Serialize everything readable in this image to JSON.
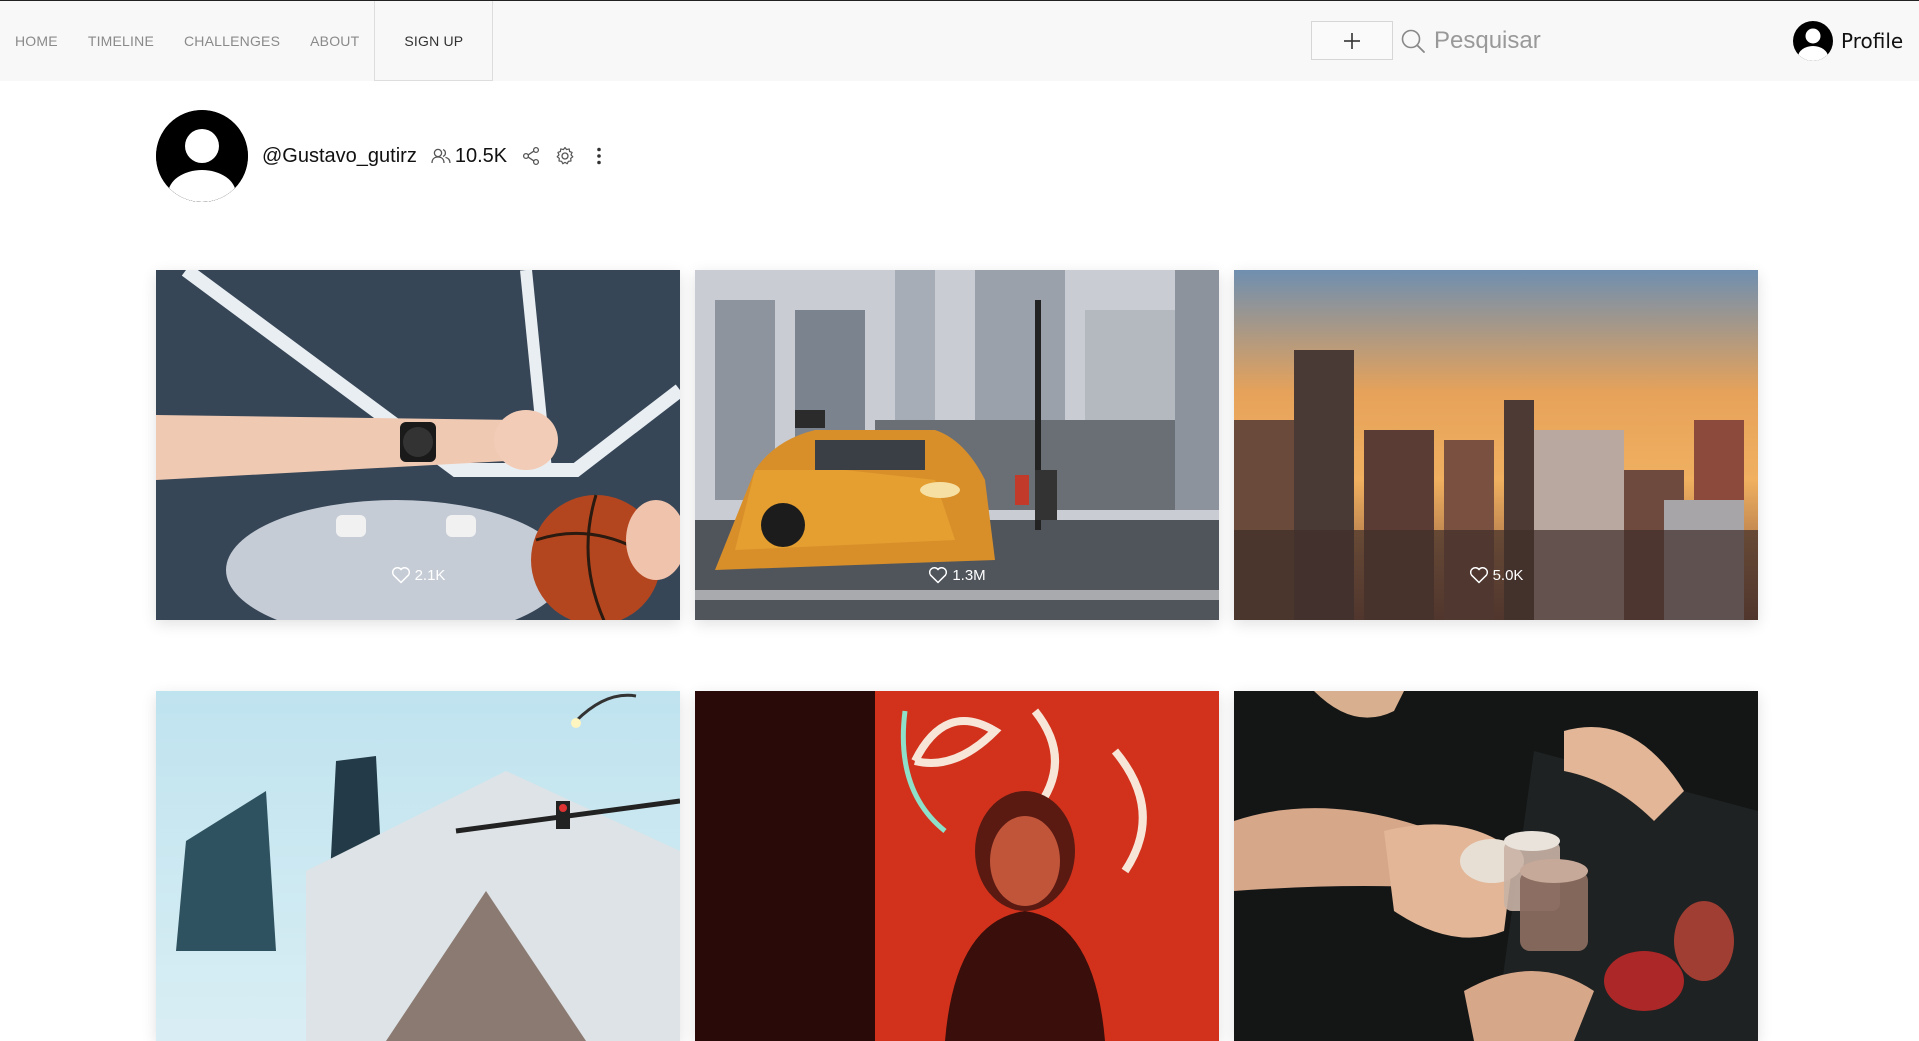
{
  "nav": {
    "items": [
      {
        "label": "HOME"
      },
      {
        "label": "TIMELINE"
      },
      {
        "label": "CHALLENGES"
      },
      {
        "label": "ABOUT"
      }
    ],
    "signup_label": "SIGN UP"
  },
  "search": {
    "placeholder": "Pesquisar",
    "value": ""
  },
  "profile": {
    "label": "Profile"
  },
  "user": {
    "handle": "@Gustavo_gutirz",
    "followers": "10.5K"
  },
  "posts": [
    {
      "likes": "2.1K",
      "subject": "wristwatch and basketball on court"
    },
    {
      "likes": "1.3M",
      "subject": "yellow taxi on city street"
    },
    {
      "likes": "5.0K",
      "subject": "city skyline at sunset"
    },
    {
      "likes": "",
      "subject": "modern building and traffic light"
    },
    {
      "likes": "",
      "subject": "woman under red neon sign"
    },
    {
      "likes": "",
      "subject": "hands holding drinks at bar"
    }
  ],
  "colors": {
    "navbar_bg": "#f8f8f8",
    "nav_text": "#8a8a8a",
    "accent_text": "#111111"
  }
}
